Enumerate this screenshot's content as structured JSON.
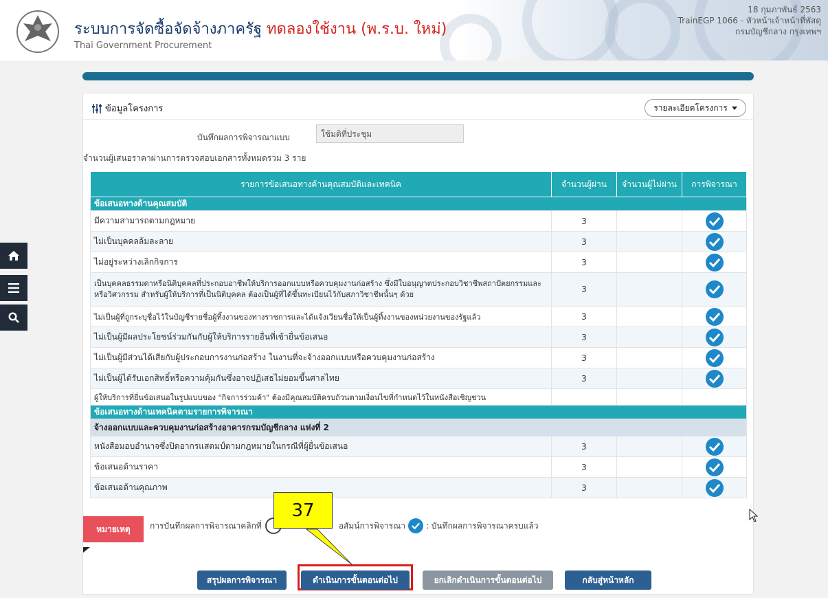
{
  "header": {
    "title": "ระบบการจัดซื้อจัดจ้างภาครัฐ",
    "title_highlight": "ทดลองใช้งาน (พ.ร.บ. ใหม่)",
    "subtitle": "Thai Government Procurement",
    "date": "18 กุมภาพันธ์ 2563",
    "user": "TrainEGP 1066 - หัวหน้าเจ้าหน้าที่พัสดุ",
    "department": "กรมบัญชีกลาง กรุงเทพฯ"
  },
  "side_nav": {
    "home": "home-icon",
    "menu": "menu-icon",
    "search": "search-icon"
  },
  "panel": {
    "title": "ข้อมูลโครงการ",
    "detail_button": "รายละเอียดโครงการ",
    "record_label": "บันทึกผลการพิจารณาแบบ",
    "record_value": "ใช้มติที่ประชุม",
    "count_text": "จำนวนผู้เสนอราคาผ่านการตรวจสอบเอกสารทั้งหมดรวม 3 ราย"
  },
  "table": {
    "headers": [
      "รายการข้อเสนอทางด้านคุณสมบัติและเทคนิค",
      "จำนวนผู้ผ่าน",
      "จำนวนผู้ไม่ผ่าน",
      "การพิจารณา"
    ],
    "section1": "ข้อเสนอทางด้านคุณสมบัติ",
    "section1_rows": [
      {
        "item": "มีความสามารถตามกฎหมาย",
        "pass": "3",
        "fail": "",
        "checked": true
      },
      {
        "item": "ไม่เป็นบุคคลล้มละลาย",
        "pass": "3",
        "fail": "",
        "checked": true
      },
      {
        "item": "ไม่อยู่ระหว่างเลิกกิจการ",
        "pass": "3",
        "fail": "",
        "checked": true
      },
      {
        "item": "เป็นบุคคลธรรมดาหรือนิติบุคคลที่ประกอบอาชีพให้บริการออกแบบหรือควบคุมงานก่อสร้าง ซึ่งมีใบอนุญาตประกอบวิชาชีพสถาปัตยกรรมและหรือวิศวกรรม สำหรับผู้ให้บริการที่เป็นนิติบุคคล ต้องเป็นผู้ที่ได้ขึ้นทะเบียนไว้กับสภาวิชาชีพนั้นๆ ด้วย",
        "pass": "3",
        "fail": "",
        "checked": true
      },
      {
        "item": "ไม่เป็นผู้ที่ถูกระบุชื่อไว้ในบัญชีรายชื่อผู้ทิ้งงานของทางราชการและได้แจ้งเวียนชื่อให้เป็นผู้ทิ้งงานของหน่วยงานของรัฐแล้ว",
        "pass": "3",
        "fail": "",
        "checked": true
      },
      {
        "item": "ไม่เป็นผู้มีผลประโยชน์ร่วมกันกับผู้ให้บริการรายอื่นที่เข้ายื่นข้อเสนอ",
        "pass": "3",
        "fail": "",
        "checked": true
      },
      {
        "item": "ไม่เป็นผู้มีส่วนได้เสียกับผู้ประกอบการงานก่อสร้าง ในงานที่จะจ้างออกแบบหรือควบคุมงานก่อสร้าง",
        "pass": "3",
        "fail": "",
        "checked": true
      },
      {
        "item": "ไม่เป็นผู้ได้รับเอกสิทธิ์หรือความคุ้มกันซึ่งอาจปฏิเสธไม่ยอมขึ้นศาลไทย",
        "pass": "3",
        "fail": "",
        "checked": true
      },
      {
        "item": "ผู้ให้บริการที่ยื่นข้อเสนอในรูปแบบของ \"กิจการร่วมค้า\" ต้องมีคุณสมบัติครบถ้วนตามเงื่อนไขที่กำหนดไว้ในหนังสือเชิญชวน",
        "pass": "",
        "fail": "",
        "checked": false
      }
    ],
    "section2": "ข้อเสนอทางด้านเทคนิคตามรายการพิจารณา",
    "subsection2": "จ้างออกแบบและควบคุมงานก่อสร้างอาคารกรมบัญชีกลาง แห่งที่ 2",
    "section2_rows": [
      {
        "item": "หนังสือมอบอำนาจซึ่งปิดอากรแสตมป์ตามกฎหมายในกรณีที่ผู้ยื่นข้อเสนอ",
        "pass": "3",
        "fail": "",
        "checked": true
      },
      {
        "item": "ข้อเสนอด้านราคา",
        "pass": "3",
        "fail": "",
        "checked": true
      },
      {
        "item": "ข้อเสนอด้านคุณภาพ",
        "pass": "3",
        "fail": "",
        "checked": true
      }
    ]
  },
  "legend": {
    "tab": "หมายเหตุ",
    "text_before": "การบันทึกผลการพิจารณาคลิกที่",
    "text_middle": "อสัมน์การพิจารณา",
    "text_after": ": บันทึกผลการพิจารณาครบแล้ว"
  },
  "buttons": {
    "summary": "สรุปผลการพิจารณา",
    "next": "ดำเนินการขั้นตอนต่อไป",
    "cancel_next": "ยกเลิกดำเนินการขั้นตอนต่อไป",
    "back_home": "กลับสู่หน้าหลัก"
  },
  "callout": {
    "number": "37"
  },
  "colors": {
    "teal": "#21aab5",
    "navy_button": "#2d5f92",
    "gray_button": "#8c96a0",
    "check": "#1e88c8",
    "highlight": "#e01b1b",
    "callout": "#ffff00",
    "note_tab": "#e8505b"
  }
}
